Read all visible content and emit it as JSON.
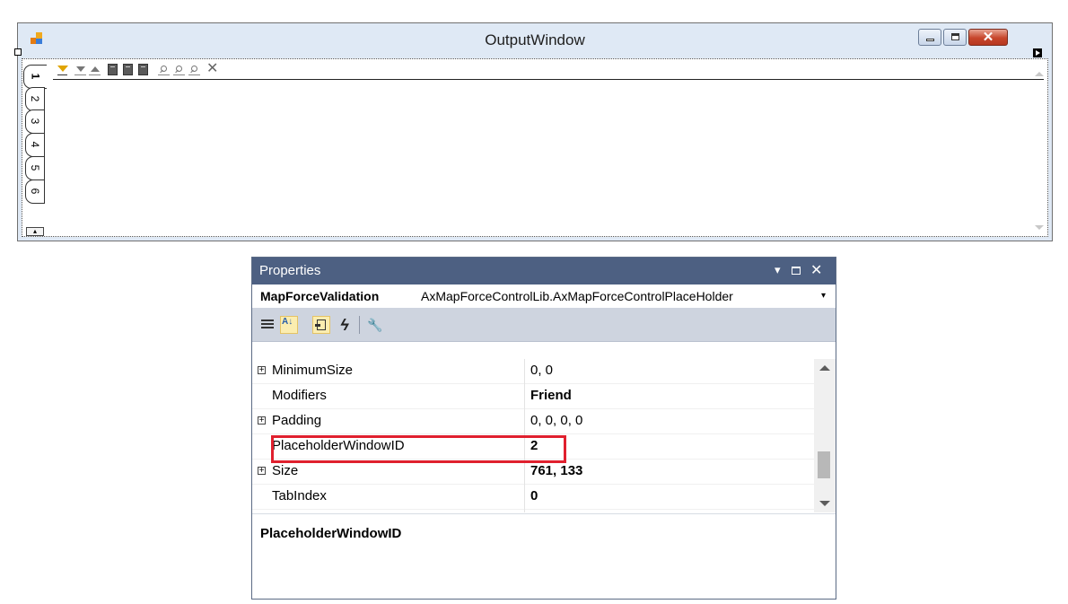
{
  "output_window": {
    "title": "OutputWindow",
    "icon": "app-window-icon",
    "close_glyph": "✕",
    "tabs": [
      {
        "label": "1",
        "active": true
      },
      {
        "label": "2",
        "active": false
      },
      {
        "label": "3",
        "active": false
      },
      {
        "label": "4",
        "active": false
      },
      {
        "label": "5",
        "active": false
      },
      {
        "label": "6",
        "active": false
      }
    ],
    "toolbar_icons": [
      "filter-icon",
      "move-down-icon",
      "move-up-icon",
      "copy-doc-icon",
      "copy-all-doc-icon",
      "save-doc-icon",
      "find-icon",
      "find-next-icon",
      "find-prev-icon",
      "clear-icon"
    ],
    "clear_glyph": "✕",
    "scroll_glyph": "▴"
  },
  "properties": {
    "title": "Properties",
    "pin_glyph": "▾",
    "close_glyph": "✕",
    "object_name": "MapForceValidation",
    "object_type": "AxMapForceControlLib.AxMapForceControlPlaceHolder",
    "dropdown_glyph": "▾",
    "toolbar": {
      "alpha_glyph": "A↓",
      "events_glyph": "ϟ",
      "pages_glyph": "🔧"
    },
    "rows": [
      {
        "name": "MinimumSize",
        "value": "0, 0",
        "expandable": true,
        "bold": false
      },
      {
        "name": "Modifiers",
        "value": "Friend",
        "expandable": false,
        "bold": true
      },
      {
        "name": "Padding",
        "value": "0, 0, 0, 0",
        "expandable": true,
        "bold": false
      },
      {
        "name": "PlaceholderWindowID",
        "value": "2",
        "expandable": false,
        "bold": true
      },
      {
        "name": "Size",
        "value": "761, 133",
        "expandable": true,
        "bold": true
      },
      {
        "name": "TabIndex",
        "value": "0",
        "expandable": false,
        "bold": true
      }
    ],
    "expander_glyph": "+",
    "description_title": "PlaceholderWindowID",
    "highlighted_row": "PlaceholderWindowID"
  },
  "colors": {
    "properties_title_bg": "#4d6082",
    "highlight_border": "#e0202e",
    "toolbar_bg": "#ced4df"
  }
}
